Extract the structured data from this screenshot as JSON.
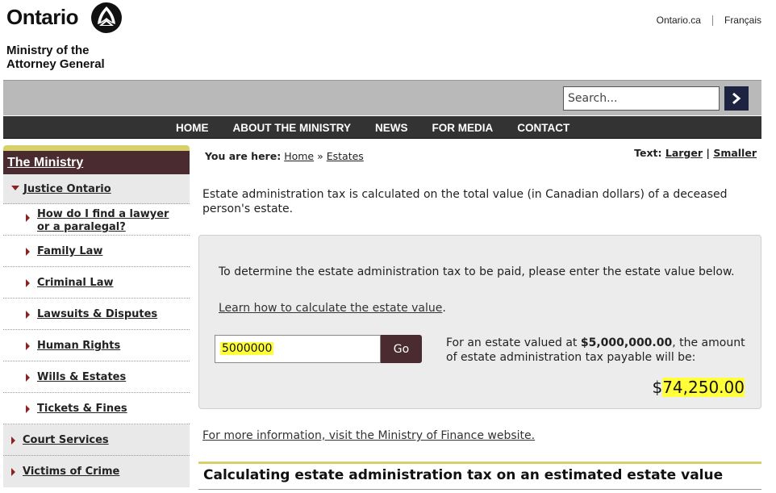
{
  "header": {
    "brand": "Ontario",
    "ministry_line1": "Ministry of the",
    "ministry_line2": "Attorney General",
    "links": [
      "Ontario.ca",
      "Français"
    ]
  },
  "search": {
    "placeholder": "Search..."
  },
  "nav": {
    "items": [
      "HOME",
      "ABOUT THE MINISTRY",
      "NEWS",
      "FOR MEDIA",
      "CONTACT"
    ]
  },
  "sidebar": {
    "heading": "The Ministry",
    "parent_item": "Justice Ontario",
    "items": [
      {
        "label_line1": "How do I find a lawyer",
        "label_line2": "or a paralegal?"
      },
      {
        "label_line1": "Family Law"
      },
      {
        "label_line1": "Criminal Law"
      },
      {
        "label_line1": "Lawsuits & Disputes"
      },
      {
        "label_line1": "Human Rights"
      },
      {
        "label_line1": "Wills & Estates"
      },
      {
        "label_line1": "Tickets & Fines"
      }
    ],
    "top_items": [
      "Court Services",
      "Victims of Crime"
    ]
  },
  "breadcrumb": {
    "prefix": "You are here:",
    "home": "Home",
    "sep": "»",
    "current": "Estates"
  },
  "text_size": {
    "prefix": "Text:",
    "larger": "Larger",
    "sep": "|",
    "smaller": "Smaller"
  },
  "intro": "Estate administration tax is calculated on the total value (in Canadian dollars) of a deceased person's estate.",
  "calculator": {
    "prompt": "To determine the estate administration tax to be paid, please enter the estate value below.",
    "learn_link": "Learn how to calculate the estate value",
    "learn_suffix": ".",
    "input_value": "5000000",
    "go_label": "Go",
    "result_prefix": "For an estate valued at ",
    "result_value": "$5,000,000.00",
    "result_suffix": ", the amount of estate administration tax payable will be:",
    "tax_symbol": "$",
    "tax_amount": "74,250.00"
  },
  "more_info": "For more information, visit the Ministry of Finance website.",
  "section_title": "Calculating estate administration tax on an estimated estate value",
  "colors": {
    "accent_maroon": "#4a2b2f",
    "accent_gold": "#d8d16b",
    "nav_dark": "#333333",
    "highlight": "#ffff3a"
  }
}
